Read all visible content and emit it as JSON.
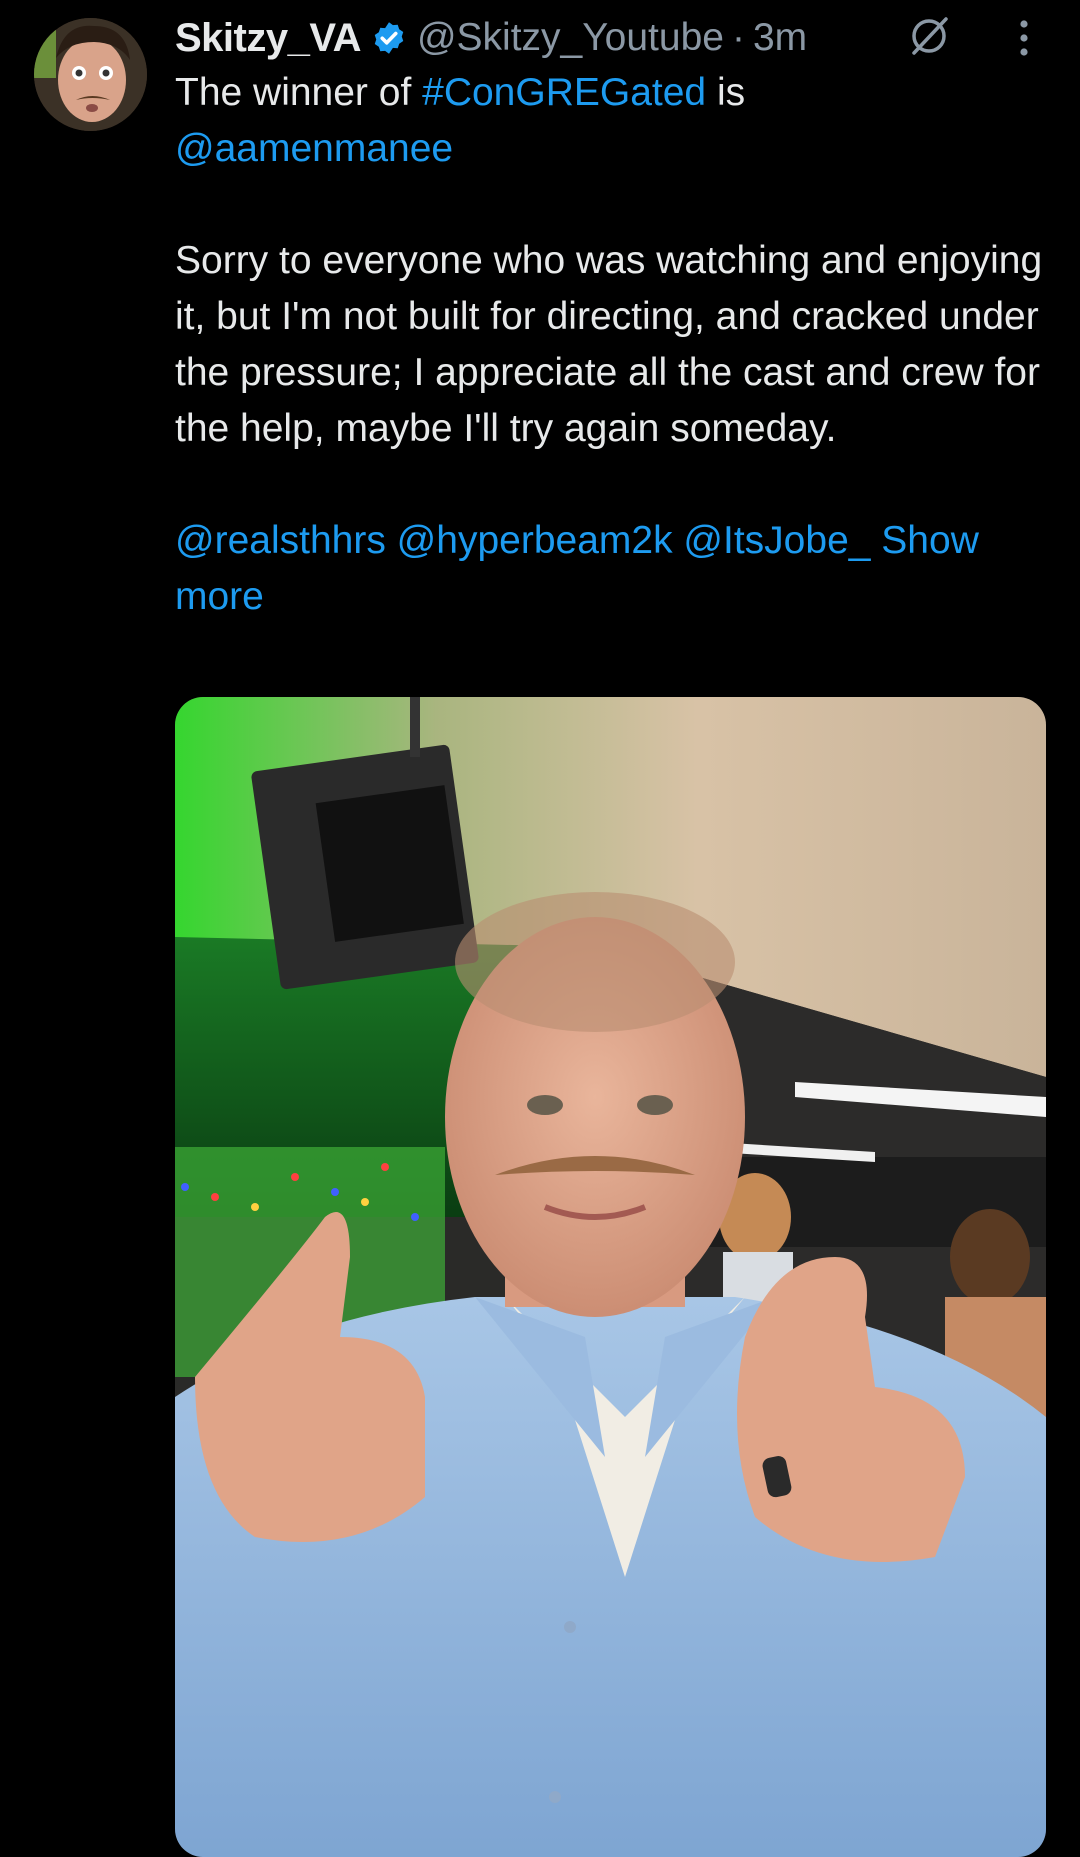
{
  "user": {
    "display_name": "Skitzy_VA",
    "handle": "@Skitzy_Youtube",
    "separator": "·",
    "time": "3m",
    "verified_icon": "verified-badge-icon"
  },
  "tweet": {
    "line1_prefix": "The winner of ",
    "hashtag": "#ConGREGated",
    "line1_suffix": " is",
    "mention_winner": "@aamenmanee",
    "body": "Sorry to everyone who was watching and enjoying it, but I'm not built for directing, and cracked under the pressure; I appreciate all the cast and crew for the help, maybe I'll try again someday.",
    "mentions": [
      "@realsthhrs",
      "@hyperbeam2k",
      "@ItsJobe_"
    ],
    "show_more": "Show more"
  },
  "icons": {
    "grok": "grok-icon",
    "more": "more-options-icon"
  },
  "colors": {
    "background": "#000000",
    "text": "#e7e9ea",
    "secondary": "#8b98a5",
    "link": "#1d9bf0"
  }
}
